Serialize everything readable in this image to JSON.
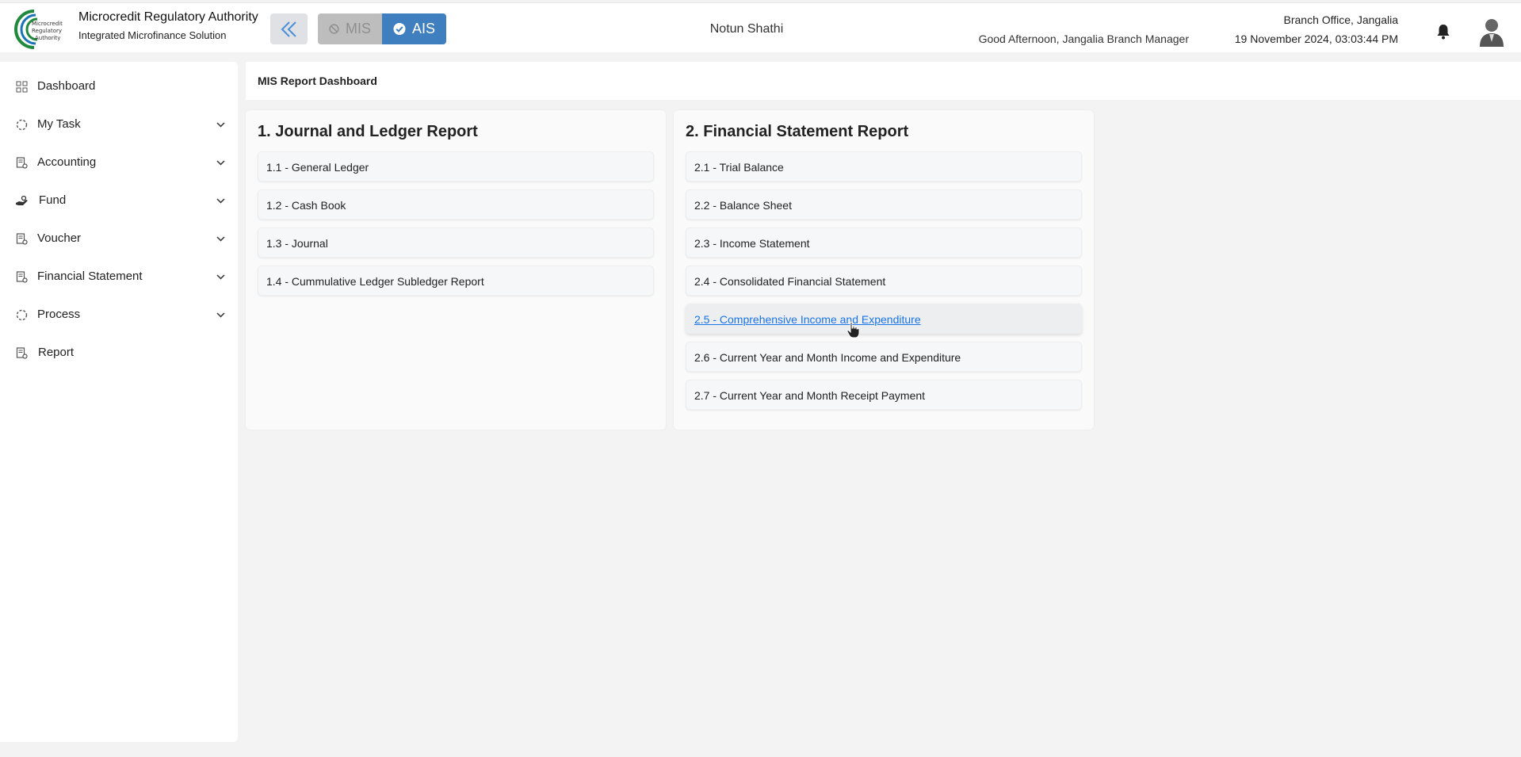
{
  "header": {
    "org_name": "Microcredit Regulatory Authority",
    "org_subtitle": "Integrated Microfinance Solution",
    "logo_text": [
      "Microcredit",
      "Regulatory",
      "Authority"
    ],
    "toggle_mis": "MIS",
    "toggle_ais": "AIS",
    "app_name": "Notun Shathi",
    "greeting": "Good Afternoon, Jangalia Branch Manager",
    "branch": "Branch Office, Jangalia",
    "datetime": "19 November 2024, 03:03:44 PM",
    "accent_color": "#3f7fbf"
  },
  "sidebar": {
    "items": [
      {
        "label": "Dashboard",
        "icon": "grid-icon",
        "expandable": false
      },
      {
        "label": "My Task",
        "icon": "dashed-circle-icon",
        "expandable": true
      },
      {
        "label": "Accounting",
        "icon": "document-gear-icon",
        "expandable": true
      },
      {
        "label": "Fund",
        "icon": "hand-money-icon",
        "expandable": true
      },
      {
        "label": "Voucher",
        "icon": "document-gear-icon",
        "expandable": true
      },
      {
        "label": "Financial Statement",
        "icon": "document-gear-icon",
        "expandable": true
      },
      {
        "label": "Process",
        "icon": "dashed-circle-icon",
        "expandable": true
      },
      {
        "label": "Report",
        "icon": "document-gear-icon",
        "expandable": false
      }
    ]
  },
  "main": {
    "breadcrumb": "MIS Report Dashboard",
    "sections": [
      {
        "title": "1. Journal and Ledger Report",
        "items": [
          "1.1 - General Ledger",
          "1.2 - Cash Book",
          "1.3 - Journal",
          "1.4 - Cummulative Ledger Subledger Report"
        ]
      },
      {
        "title": "2. Financial Statement Report",
        "items": [
          "2.1 - Trial Balance",
          "2.2 - Balance Sheet",
          "2.3 - Income Statement",
          "2.4 - Consolidated Financial Statement",
          "2.5 - Comprehensive Income and Expenditure",
          "2.6 - Current Year and Month Income and Expenditure",
          "2.7 - Current Year and Month Receipt Payment"
        ]
      }
    ],
    "hovered_item": "2.5 - Comprehensive Income and Expenditure",
    "link_color": "#1a73e8"
  }
}
